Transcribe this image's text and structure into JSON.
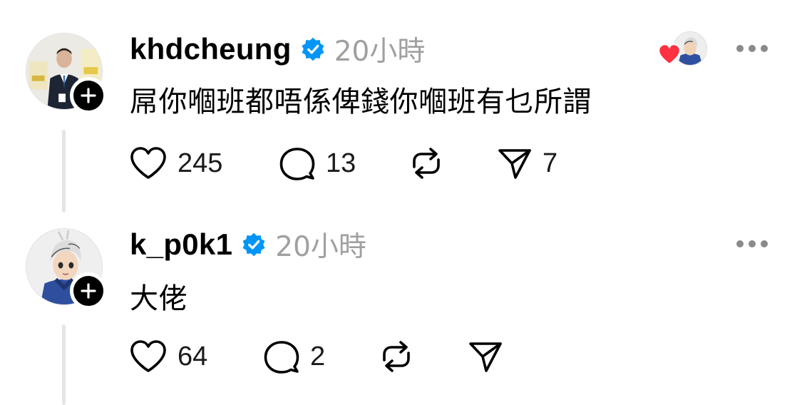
{
  "posts": [
    {
      "username": "khdcheung",
      "verified": true,
      "timestamp": "20小時",
      "text": "屌你嗰班都唔係俾錢你嗰班有乜所謂",
      "avatar_icon": "man-in-suit-avatar",
      "liked_by_author": true,
      "actions": {
        "likes": "245",
        "replies": "13",
        "reposts": "",
        "shares": "7"
      }
    },
    {
      "username": "k_p0k1",
      "verified": true,
      "timestamp": "20小時",
      "text": "大佬",
      "avatar_icon": "anime-character-avatar",
      "liked_by_author": false,
      "actions": {
        "likes": "64",
        "replies": "2",
        "reposts": "",
        "shares": ""
      }
    }
  ],
  "colors": {
    "verified_blue": "#0095f6",
    "heart_red": "#ff3040",
    "muted_text": "#a0a0a0",
    "thread_line": "#e5e5e5"
  }
}
